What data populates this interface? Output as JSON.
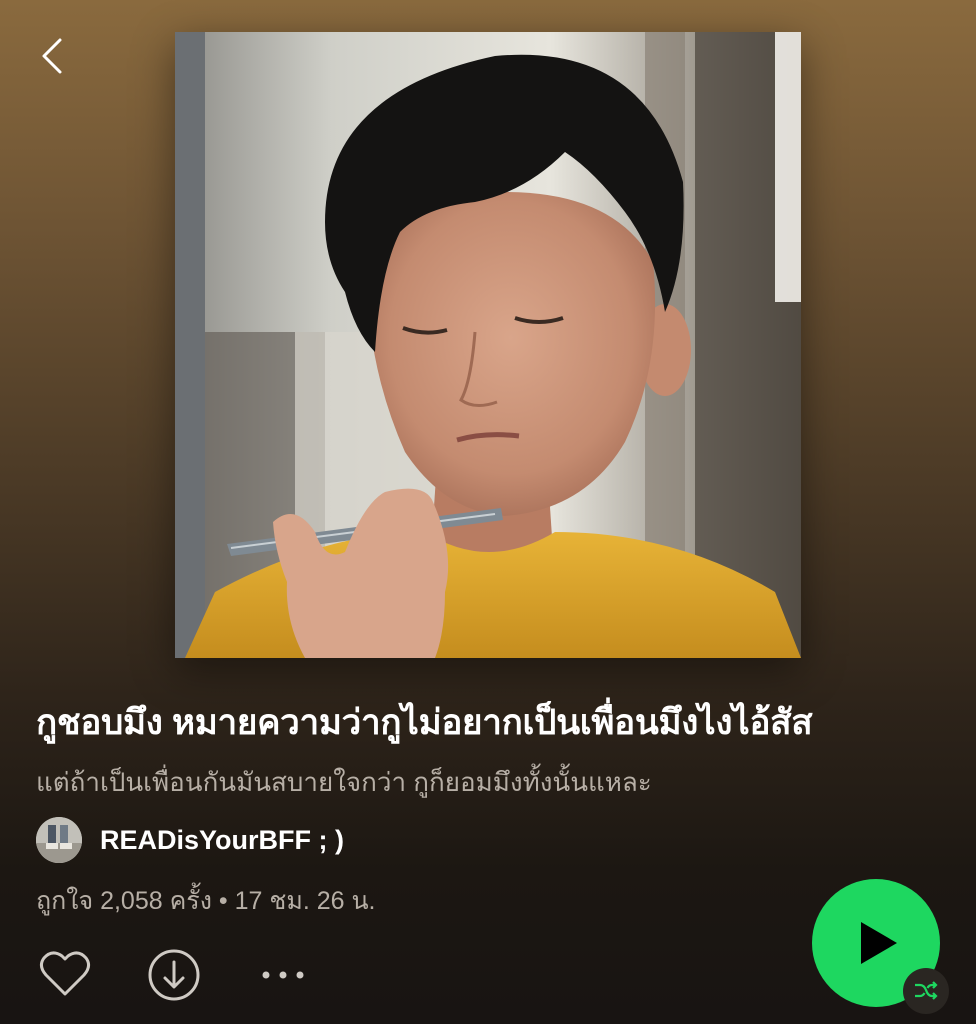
{
  "navigation": {
    "back_icon": "chevron-left-icon"
  },
  "playlist": {
    "cover_art": "photo of a man with a phone held near his face",
    "title": "กูชอบมึง หมายความว่ากูไม่อยากเป็นเพื่อนมึงไงไอ้สัส",
    "description": "แต่ถ้าเป็นเพื่อนกันมันสบายใจกว่า กูก็ยอมมึงทั้งนั้นแหละ",
    "owner_name": "READisYourBFF ; )",
    "likes_text": "ถูกใจ 2,058 ครั้ง",
    "separator": "•",
    "duration_text": "17 ชม. 26 น."
  },
  "actions": {
    "like_icon": "heart-outline-icon",
    "download_icon": "download-circle-icon",
    "more_icon": "ellipsis-icon",
    "play_icon": "play-icon",
    "shuffle_icon": "shuffle-icon"
  },
  "colors": {
    "accent": "#1ed760",
    "background_top": "#8a6a3e",
    "background_bottom": "#181412",
    "secondary_text": "#b7afa6",
    "shuffle_active": "#1ed760"
  }
}
